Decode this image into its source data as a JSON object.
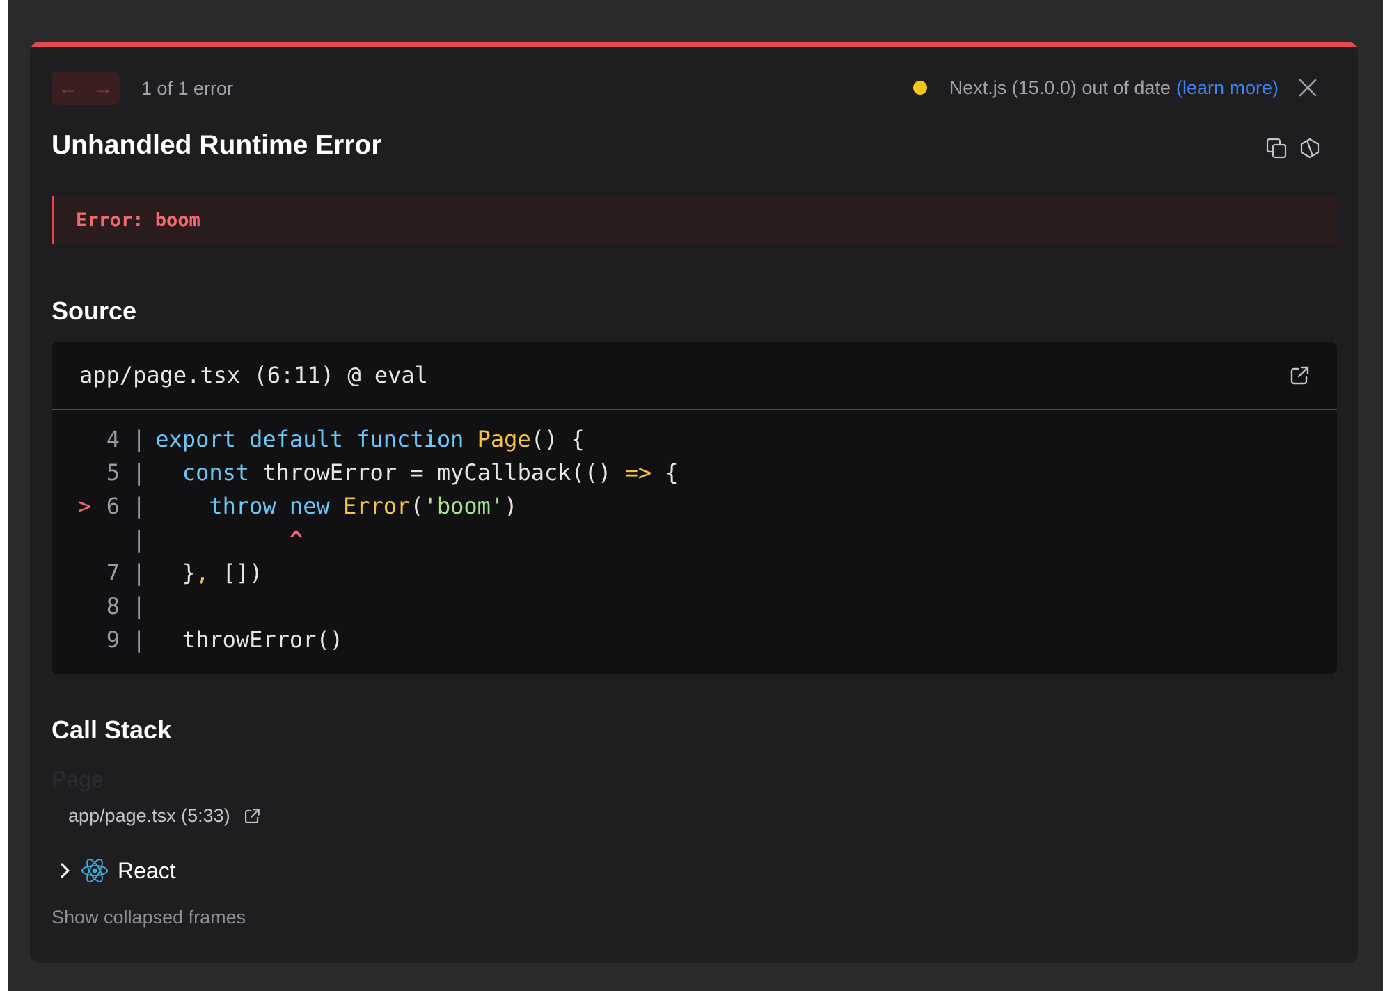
{
  "nav": {
    "prev_label": "←",
    "next_label": "→",
    "error_count": "1 of 1 error"
  },
  "version": {
    "text": "Next.js (15.0.0) out of date",
    "link": "(learn more)",
    "status_color": "#f5c518"
  },
  "title": "Unhandled Runtime Error",
  "error_message": "Error: boom",
  "source": {
    "heading": "Source",
    "file": "app/page.tsx (6:11) @ eval",
    "code": [
      {
        "marker": "",
        "num": "4",
        "tokens": [
          "export default function ",
          "Page",
          "() {"
        ]
      },
      {
        "marker": "",
        "num": "5",
        "tokens": [
          "  const ",
          "throwError = myCallback(() ",
          "=>",
          " {"
        ]
      },
      {
        "marker": ">",
        "num": "6",
        "tokens": [
          "    throw new ",
          "Error",
          "(",
          "'boom'",
          ")"
        ]
      },
      {
        "marker": "",
        "num": "",
        "tokens": [
          "          ^"
        ]
      },
      {
        "marker": "",
        "num": "7",
        "tokens": [
          "  }",
          ",",
          " [])"
        ]
      },
      {
        "marker": "",
        "num": "8",
        "tokens": [
          ""
        ]
      },
      {
        "marker": "",
        "num": "9",
        "tokens": [
          "  throwError()"
        ]
      }
    ]
  },
  "call_stack": {
    "heading": "Call Stack",
    "frame_name": "Page",
    "frame_location": "app/page.tsx (5:33)",
    "group_label": "React",
    "show_collapsed": "Show collapsed frames"
  },
  "colors": {
    "accent_error": "#e5484d",
    "link": "#3b82f6",
    "keyword": "#6cc7f6",
    "function": "#f5c543",
    "string": "#a8e28b"
  },
  "icons": [
    "arrow-left-icon",
    "arrow-right-icon",
    "close-icon",
    "copy-icon",
    "docs-icon",
    "external-link-icon",
    "chevron-right-icon",
    "react-logo-icon"
  ]
}
